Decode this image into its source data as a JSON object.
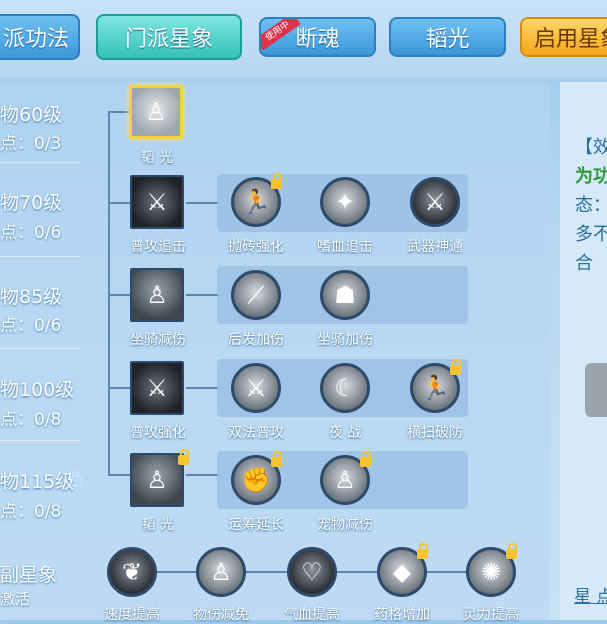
{
  "tabs": {
    "t1": "派功法",
    "t2": "门派星象",
    "t3": "断魂",
    "t3_badge": "使用中",
    "t4": "韬光",
    "t5": "启用星象"
  },
  "tiers": [
    {
      "level": "物60级",
      "points": "点：0/3"
    },
    {
      "level": "物70级",
      "points": "点：0/6"
    },
    {
      "level": "物85级",
      "points": "点：0/6"
    },
    {
      "level": "物100级",
      "points": "点：0/8"
    },
    {
      "level": "物115级",
      "points": "点：0/8"
    }
  ],
  "bottom_left": {
    "title": "副星象",
    "sub": "激活"
  },
  "skills": {
    "row1": {
      "main": "韬 光"
    },
    "row2": {
      "main": "普攻追击",
      "subs": [
        "抛砖强化",
        "嗜血追击",
        "武器神通"
      ]
    },
    "row3": {
      "main": "坐骑减伤",
      "subs": [
        "后发加伤",
        "坐骑加伤"
      ]
    },
    "row4": {
      "main": "普攻强化",
      "subs": [
        "双法普攻",
        "夜 战",
        "横扫破防"
      ]
    },
    "row5": {
      "main": "韬 光",
      "subs": [
        "运筹延长",
        "宠物减伤"
      ]
    },
    "bottom": [
      "速度提高",
      "物伤减免",
      "气血提高",
      "药格增加",
      "灵力提高"
    ]
  },
  "right_panel": {
    "lines": [
      "【效",
      "为功",
      "态：",
      "多不",
      "合"
    ],
    "footer": "星 点"
  }
}
